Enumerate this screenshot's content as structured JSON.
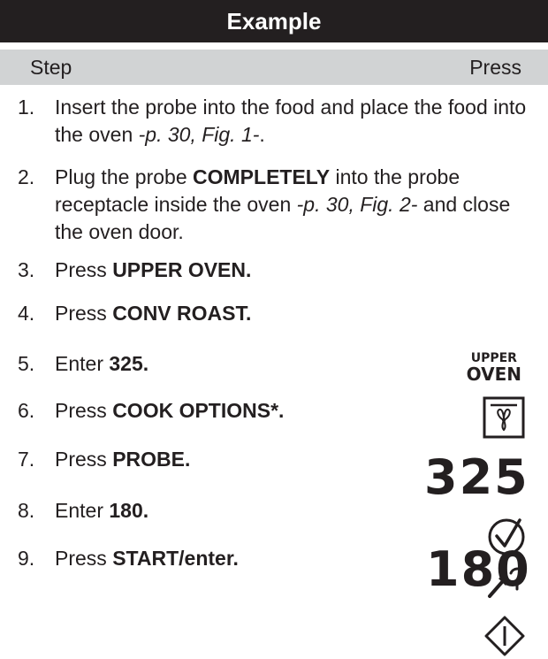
{
  "title": "Example",
  "header": {
    "step": "Step",
    "press": "Press"
  },
  "steps": [
    {
      "num": "1.",
      "parts": [
        {
          "t": "Insert the probe into the food and place the food into the oven "
        },
        {
          "t": "-p. 30, Fig. 1-",
          "i": true
        },
        {
          "t": "."
        }
      ]
    },
    {
      "num": "2.",
      "parts": [
        {
          "t": "Plug the probe "
        },
        {
          "t": "COMPLETELY",
          "b": true
        },
        {
          "t": " into the probe receptacle inside the oven "
        },
        {
          "t": "-p. 30, Fig. 2-",
          "i": true
        },
        {
          "t": " and close the oven door."
        }
      ]
    },
    {
      "num": "3.",
      "parts": [
        {
          "t": "Press "
        },
        {
          "t": "UPPER OVEN.",
          "b": true
        }
      ]
    },
    {
      "num": "4.",
      "parts": [
        {
          "t": "Press "
        },
        {
          "t": "CONV ROAST.",
          "b": true
        }
      ]
    },
    {
      "num": "5.",
      "parts": [
        {
          "t": "Enter "
        },
        {
          "t": "325.",
          "b": true
        }
      ]
    },
    {
      "num": "6.",
      "parts": [
        {
          "t": "Press "
        },
        {
          "t": "COOK OPTIONS*.",
          "b": true
        }
      ]
    },
    {
      "num": "7.",
      "parts": [
        {
          "t": "Press "
        },
        {
          "t": "PROBE.",
          "b": true
        }
      ]
    },
    {
      "num": "8.",
      "parts": [
        {
          "t": "Enter "
        },
        {
          "t": "180.",
          "b": true
        }
      ]
    },
    {
      "num": "9.",
      "parts": [
        {
          "t": "Press "
        },
        {
          "t": "START/enter.",
          "b": true
        }
      ]
    }
  ],
  "press_icons": {
    "upper_oven_line1": "UPPER",
    "upper_oven_line2": "OVEN",
    "conv_roast": "fan-icon",
    "temp_display": "325",
    "cook_options": "checkmark-circle-icon",
    "probe": "probe-icon",
    "probe_temp_display": "180",
    "start": "start-diamond-icon"
  },
  "colors": {
    "title_bg": "#231f20",
    "header_bg": "#d1d3d4",
    "text": "#231f20"
  }
}
